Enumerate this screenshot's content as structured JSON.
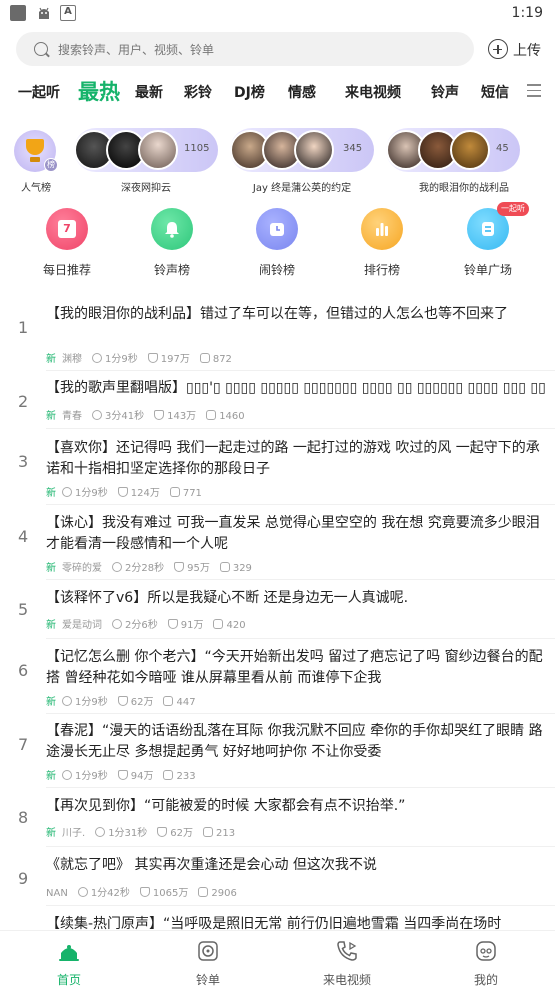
{
  "status_bar": {
    "time": "1:19",
    "icons": [
      "app-icon",
      "android-icon",
      "a-icon"
    ],
    "a_glyph": "A"
  },
  "search": {
    "placeholder": "搜索铃声、用户、视频、铃单",
    "upload_label": "上传"
  },
  "tabs": [
    "一起听",
    "最热",
    "最新",
    "彩铃",
    "DJ榜",
    "情感",
    "来电视频",
    "铃声",
    "短信"
  ],
  "active_tab": "最热",
  "rankings": [
    {
      "label": "人气榜",
      "badge": "榜"
    },
    {
      "label": "深夜网抑云",
      "count": "1105"
    },
    {
      "label": "Jay 终是蒲公英的约定",
      "count": "345"
    },
    {
      "label": "我的眼泪你的战利品",
      "count": "45"
    }
  ],
  "features": [
    {
      "label": "每日推荐",
      "icon": "calendar-icon",
      "day": "7"
    },
    {
      "label": "铃声榜",
      "icon": "bell-icon"
    },
    {
      "label": "闹铃榜",
      "icon": "alarm-icon"
    },
    {
      "label": "排行榜",
      "icon": "bar-chart-icon"
    },
    {
      "label": "铃单广场",
      "icon": "playlist-icon",
      "badge": "一起听"
    }
  ],
  "songs": [
    {
      "num": "1",
      "title": "【我的眼泪你的战利品】错过了车可以在等，但错过的人怎么也等不回来了",
      "is_new": true,
      "new_label": "新",
      "author": "渊穆",
      "duration": "1分9秒",
      "likes": "197万",
      "comments": "872"
    },
    {
      "num": "2",
      "title": "【我的歌声里翻唱版】▯▯▯'▯ ▯▯▯▯ ▯▯▯▯▯ ▯▯▯▯▯▯▯ ▯▯▯▯ ▯▯ ▯▯▯▯▯▯ ▯▯▯▯ ▯▯▯ ▯▯▯▯▯",
      "is_new": true,
      "new_label": "新",
      "author": "青春",
      "duration": "3分41秒",
      "likes": "143万",
      "comments": "1460"
    },
    {
      "num": "3",
      "title": "【喜欢你】还记得吗 我们一起走过的路 一起打过的游戏 吹过的风 一起守下的承诺和十指相扣坚定选择你的那段日子",
      "is_new": true,
      "new_label": "新",
      "author": "",
      "duration": "1分9秒",
      "likes": "124万",
      "comments": "771"
    },
    {
      "num": "4",
      "title": "【诛心】我没有难过 可我一直发呆 总觉得心里空空的 我在想 究竟要流多少眼泪才能看清一段感情和一个人呢",
      "is_new": true,
      "new_label": "新",
      "author": "零碎的爱",
      "duration": "2分28秒",
      "likes": "95万",
      "comments": "329"
    },
    {
      "num": "5",
      "title": "【该释怀了v6】所以是我疑心不断 还是身边无一人真诚呢.",
      "is_new": true,
      "new_label": "新",
      "author": "爱是动词",
      "duration": "2分6秒",
      "likes": "91万",
      "comments": "420"
    },
    {
      "num": "6",
      "title": "【记忆怎么删 你个老六】“今天开始新出发吗 留过了疤忘记了吗 窗纱边餐台的配搭 曾经种花如今暗哑 谁从屏幕里看从前 而谁停下企我",
      "is_new": true,
      "new_label": "新",
      "author": "",
      "duration": "1分9秒",
      "likes": "62万",
      "comments": "447"
    },
    {
      "num": "7",
      "title": "【春泥】“漫天的话语纷乱落在耳际 你我沉默不回应 牵你的手你却哭红了眼睛 路途漫长无止尽 多想提起勇气 好好地呵护你 不让你受委",
      "is_new": true,
      "new_label": "新",
      "author": "",
      "duration": "1分9秒",
      "likes": "94万",
      "comments": "233"
    },
    {
      "num": "8",
      "title": "【再次见到你】“可能被爱的时候 大家都会有点不识抬举.”",
      "is_new": true,
      "new_label": "新",
      "author": "川子.",
      "duration": "1分31秒",
      "likes": "62万",
      "comments": "213"
    },
    {
      "num": "9",
      "title": "《就忘了吧》 其实再次重逢还是会心动 但这次我不说",
      "is_new": false,
      "new_label": "",
      "author": "NAN",
      "duration": "1分42秒",
      "likes": "1065万",
      "comments": "2906"
    },
    {
      "num": "10",
      "title": "【续集-热门原声】“当呼吸是照旧无常 前行仍旧遍地雪霜 当四季尚在场时",
      "is_new": false,
      "new_label": "",
      "author": "",
      "duration": "",
      "likes": "",
      "comments": ""
    }
  ],
  "bottom_nav": [
    {
      "label": "首页",
      "icon": "home-icon",
      "active": true
    },
    {
      "label": "铃单",
      "icon": "playlist-disc-icon",
      "active": false
    },
    {
      "label": "来电视频",
      "icon": "phone-video-icon",
      "active": false
    },
    {
      "label": "我的",
      "icon": "profile-icon",
      "active": false
    }
  ],
  "colors": {
    "accent": "#16b36a",
    "pill": "#cbc6f6",
    "badge": "#ef4b55"
  }
}
